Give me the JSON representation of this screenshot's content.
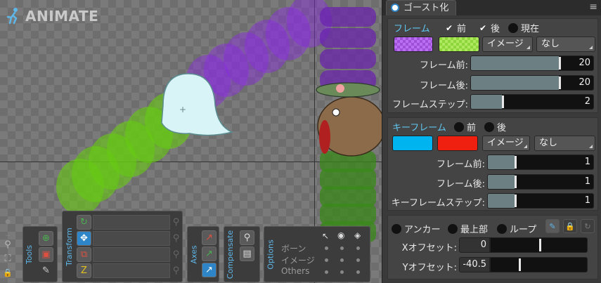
{
  "app": {
    "logo_text": "ANIMATE"
  },
  "bottom_panels": {
    "tools_label": "Tools",
    "transform_label": "Transform",
    "axes_label": "Axes",
    "compensate_label": "Compensate",
    "options_label": "Options",
    "options_rows": [
      "ボーン",
      "イメージ",
      "Others"
    ]
  },
  "panel": {
    "tab_title": "ゴースト化",
    "frames": {
      "title": "フレーム",
      "before_label": "前",
      "after_label": "後",
      "current_label": "現在",
      "before_checked": true,
      "after_checked": true,
      "current_checked": false,
      "before_color": "#a050d8",
      "after_color": "#8ed63a",
      "blend_mode": "イメージ",
      "tint_mode": "なし",
      "frames_before_label": "フレーム前:",
      "frames_before_value": "20",
      "frames_after_label": "フレーム後:",
      "frames_after_value": "20",
      "frame_step_label": "フレームステップ:",
      "frame_step_value": "2"
    },
    "keys": {
      "title": "キーフレーム",
      "before_label": "前",
      "after_label": "後",
      "before_color": "#00b4f0",
      "after_color": "#f02010",
      "blend_mode": "イメージ",
      "tint_mode": "なし",
      "keys_before_label": "フレーム前:",
      "keys_before_value": "1",
      "keys_after_label": "フレーム後:",
      "keys_after_value": "1",
      "key_step_label": "キーフレームステップ:",
      "key_step_value": "1"
    },
    "anchor": {
      "anchor_label": "アンカー",
      "top_label": "最上部",
      "loop_label": "ループ",
      "x_offset_label": "Xオフセット:",
      "x_offset_value": "0",
      "y_offset_label": "Yオフセット:",
      "y_offset_value": "-40.5"
    }
  }
}
